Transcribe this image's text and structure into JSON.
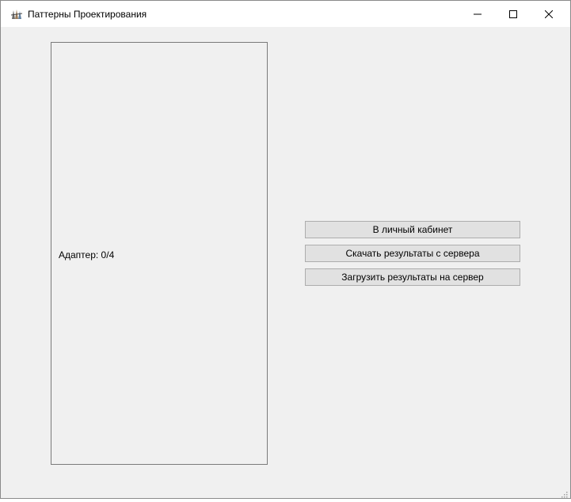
{
  "window": {
    "title": "Паттерны Проектирования",
    "app_icon": "app-icon",
    "controls": {
      "minimize_icon": "minimize-icon",
      "maximize_icon": "maximize-icon",
      "close_icon": "close-icon"
    }
  },
  "panel": {
    "adapter_label": "Адаптер: 0/4"
  },
  "actions": {
    "cabinet_label": "В личный кабинет",
    "download_label": "Скачать результаты с сервера",
    "upload_label": "Загрузить результаты на сервер"
  }
}
